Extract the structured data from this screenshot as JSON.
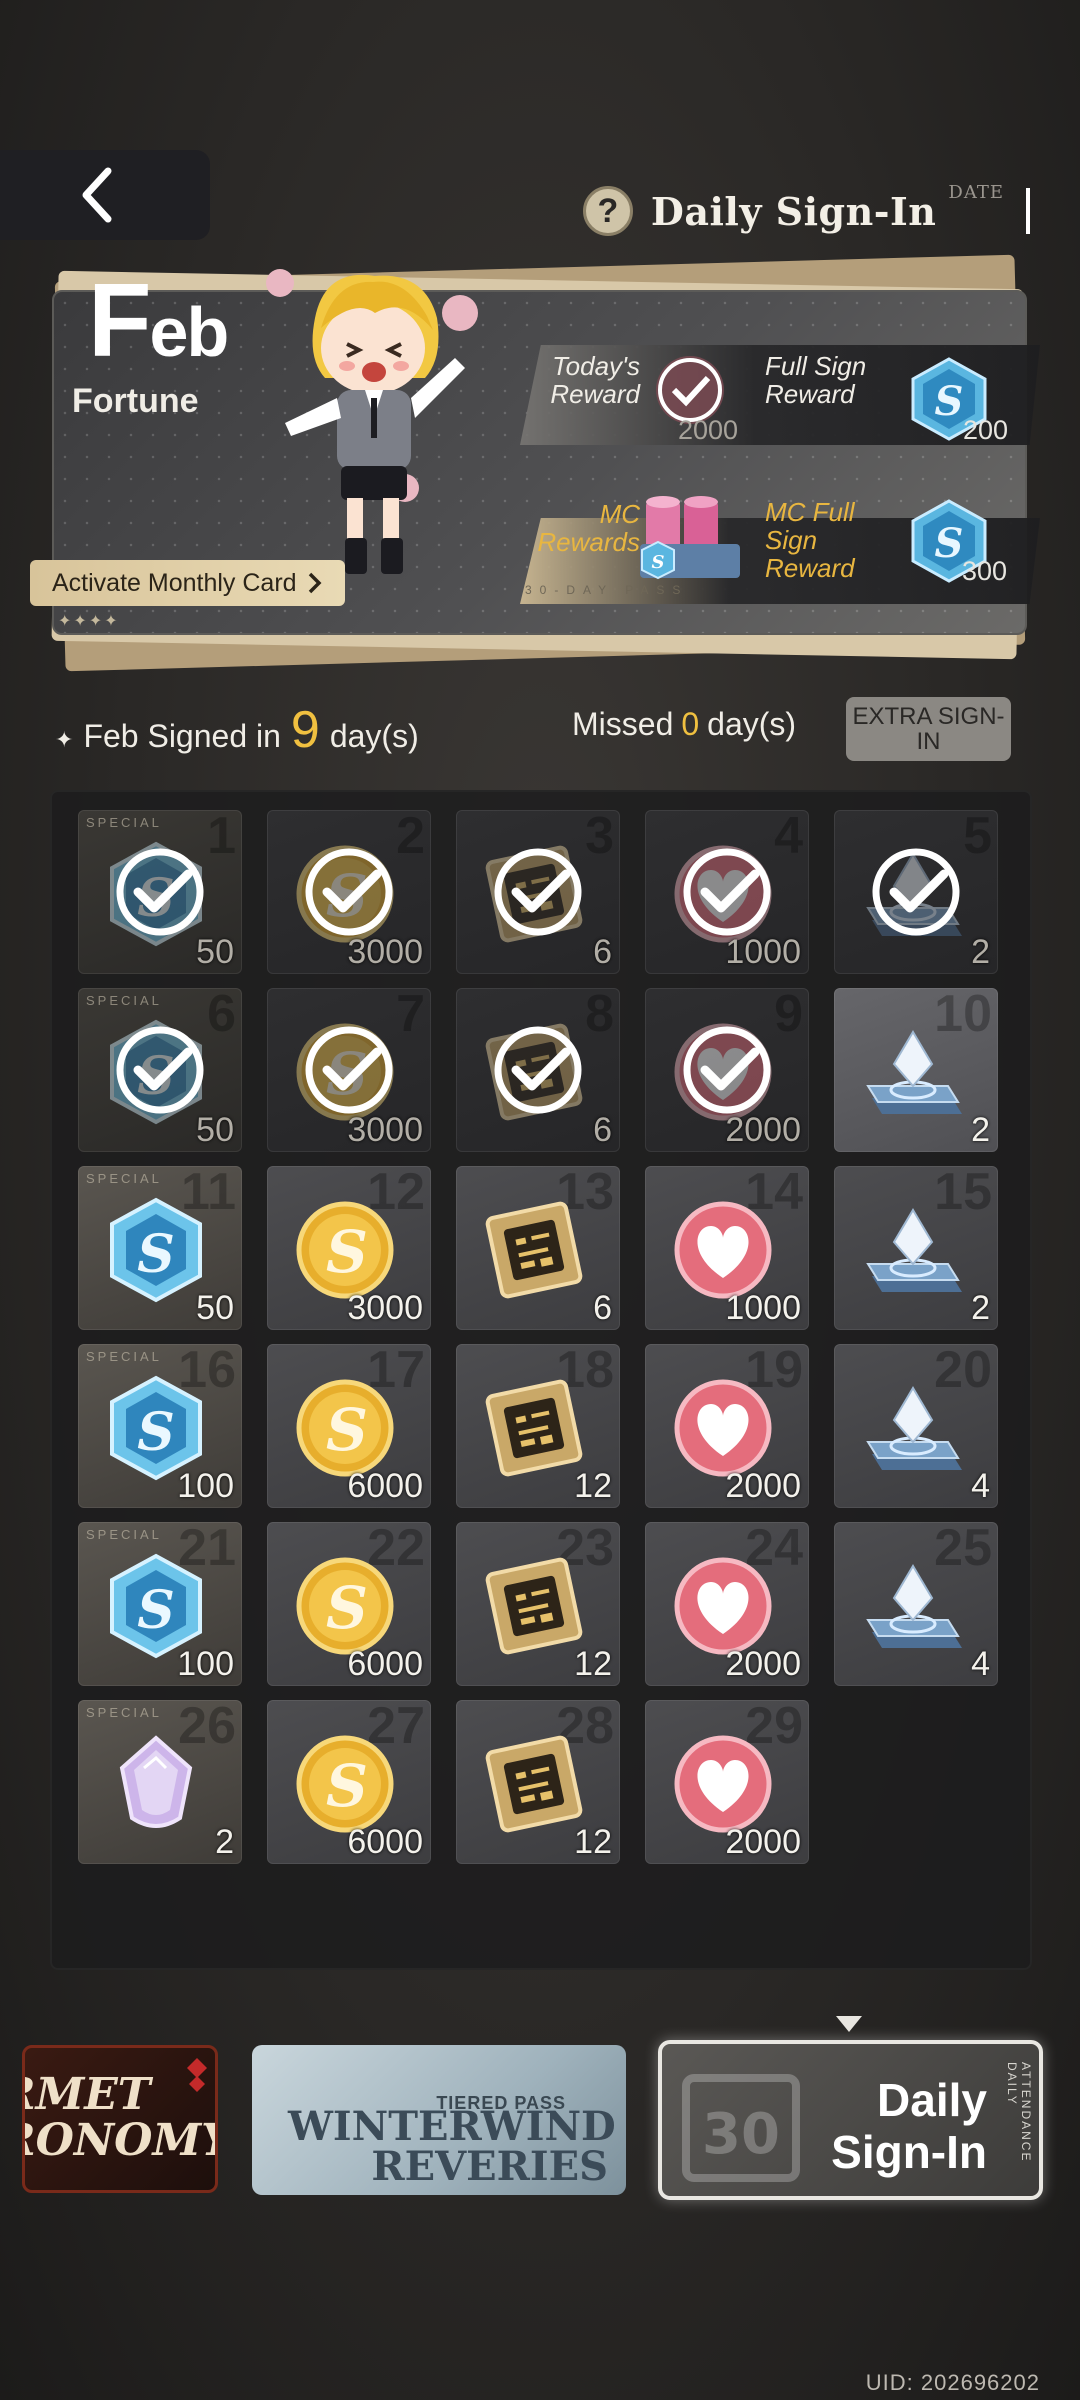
{
  "header": {
    "back_icon": "chevron-left-icon",
    "help_icon": "?",
    "title": "Daily Sign-In",
    "title_tag": "DATE"
  },
  "banner": {
    "month_first": "F",
    "month_rest": "eb",
    "subtitle": "Fortune",
    "monthly_card_button": "Activate Monthly Card",
    "todays_reward_label": "Today's Reward",
    "todays_reward_amount": "2000",
    "full_sign_label": "Full Sign Reward",
    "full_sign_amount": "200",
    "mc_rewards_label": "MC Rewards",
    "mc_full_label": "MC Full Sign Reward",
    "mc_full_amount": "300",
    "pass_tag": "30-DAY PASS"
  },
  "stats": {
    "signed_prefix": "Feb Signed in",
    "signed_count": "9",
    "signed_suffix": "day(s)",
    "missed_prefix": "Missed",
    "missed_count": "0",
    "missed_suffix": "day(s)",
    "extra_button": "EXTRA SIGN-IN"
  },
  "special_tag": "SPECIAL",
  "days": [
    {
      "day": "1",
      "qty": "50",
      "item": "gem",
      "special": true,
      "signed": true
    },
    {
      "day": "2",
      "qty": "3000",
      "item": "coin",
      "special": false,
      "signed": true
    },
    {
      "day": "3",
      "qty": "6",
      "item": "chip",
      "special": false,
      "signed": true
    },
    {
      "day": "4",
      "qty": "1000",
      "item": "heart",
      "special": false,
      "signed": true
    },
    {
      "day": "5",
      "qty": "2",
      "item": "crystal",
      "special": false,
      "signed": true
    },
    {
      "day": "6",
      "qty": "50",
      "item": "gem",
      "special": true,
      "signed": true
    },
    {
      "day": "7",
      "qty": "3000",
      "item": "coin",
      "special": false,
      "signed": true
    },
    {
      "day": "8",
      "qty": "6",
      "item": "chip",
      "special": false,
      "signed": true
    },
    {
      "day": "9",
      "qty": "2000",
      "item": "heart",
      "special": false,
      "signed": true
    },
    {
      "day": "10",
      "qty": "2",
      "item": "crystal",
      "special": false,
      "signed": false,
      "today": true
    },
    {
      "day": "11",
      "qty": "50",
      "item": "gem",
      "special": true,
      "signed": false
    },
    {
      "day": "12",
      "qty": "3000",
      "item": "coin",
      "special": false,
      "signed": false
    },
    {
      "day": "13",
      "qty": "6",
      "item": "chip",
      "special": false,
      "signed": false
    },
    {
      "day": "14",
      "qty": "1000",
      "item": "heart",
      "special": false,
      "signed": false
    },
    {
      "day": "15",
      "qty": "2",
      "item": "crystal",
      "special": false,
      "signed": false
    },
    {
      "day": "16",
      "qty": "100",
      "item": "gem",
      "special": true,
      "signed": false
    },
    {
      "day": "17",
      "qty": "6000",
      "item": "coin",
      "special": false,
      "signed": false
    },
    {
      "day": "18",
      "qty": "12",
      "item": "chip",
      "special": false,
      "signed": false
    },
    {
      "day": "19",
      "qty": "2000",
      "item": "heart",
      "special": false,
      "signed": false
    },
    {
      "day": "20",
      "qty": "4",
      "item": "crystal",
      "special": false,
      "signed": false
    },
    {
      "day": "21",
      "qty": "100",
      "item": "gem",
      "special": true,
      "signed": false
    },
    {
      "day": "22",
      "qty": "6000",
      "item": "coin",
      "special": false,
      "signed": false
    },
    {
      "day": "23",
      "qty": "12",
      "item": "chip",
      "special": false,
      "signed": false
    },
    {
      "day": "24",
      "qty": "2000",
      "item": "heart",
      "special": false,
      "signed": false
    },
    {
      "day": "25",
      "qty": "4",
      "item": "crystal",
      "special": false,
      "signed": false
    },
    {
      "day": "26",
      "qty": "2",
      "item": "prism",
      "special": true,
      "signed": false
    },
    {
      "day": "27",
      "qty": "6000",
      "item": "coin",
      "special": false,
      "signed": false
    },
    {
      "day": "28",
      "qty": "12",
      "item": "chip",
      "special": false,
      "signed": false
    },
    {
      "day": "29",
      "qty": "2000",
      "item": "heart",
      "special": false,
      "signed": false
    }
  ],
  "tabs": {
    "gourmet_line1": "RMET",
    "gourmet_line2": "RONOMY",
    "winter_sub": "TIERED PASS",
    "winter_line1": "WINTERWIND",
    "winter_line2": "REVERIES",
    "daily_line1": "Daily",
    "daily_line2": "Sign-In",
    "daily_vertical": "ATTENDANCE DAILY"
  },
  "uid": "UID: 202696202",
  "colors": {
    "accent_gold": "#f0c040",
    "background": "#2a2826"
  }
}
